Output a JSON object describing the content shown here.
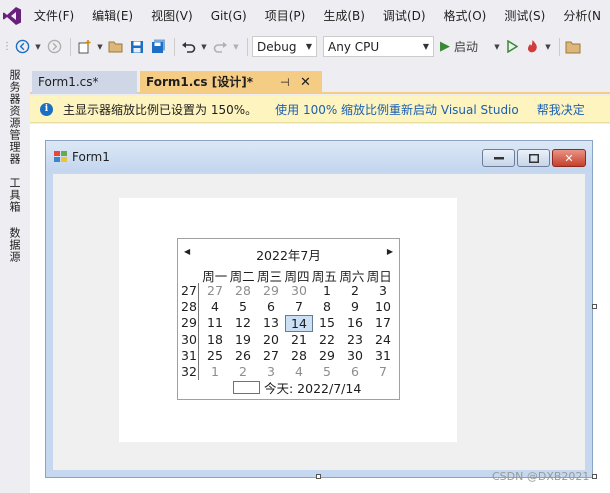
{
  "menu": [
    "文件(F)",
    "编辑(E)",
    "视图(V)",
    "Git(G)",
    "项目(P)",
    "生成(B)",
    "调试(D)",
    "格式(O)",
    "测试(S)",
    "分析(N"
  ],
  "toolbar": {
    "config": "Debug",
    "platform": "Any CPU",
    "start_label": "启动"
  },
  "left_tabs": [
    "服务器资源管理器",
    "工具箱",
    "数据源"
  ],
  "tabs": {
    "inactive": "Form1.cs*",
    "active": "Form1.cs [设计]*"
  },
  "infobar": {
    "message": "主显示器缩放比例已设置为 150%。",
    "link1": "使用 100% 缩放比例重新启动 Visual Studio",
    "link2": "帮我决定"
  },
  "form": {
    "title": "Form1"
  },
  "calendar": {
    "month_title": "2022年7月",
    "weekdays": [
      "周一",
      "周二",
      "周三",
      "周四",
      "周五",
      "周六",
      "周日"
    ],
    "week_numbers": [
      "27",
      "28",
      "29",
      "30",
      "31",
      "32"
    ],
    "rows": [
      [
        {
          "d": "27",
          "dim": true
        },
        {
          "d": "28",
          "dim": true
        },
        {
          "d": "29",
          "dim": true
        },
        {
          "d": "30",
          "dim": true
        },
        {
          "d": "1"
        },
        {
          "d": "2"
        },
        {
          "d": "3"
        }
      ],
      [
        {
          "d": "4"
        },
        {
          "d": "5"
        },
        {
          "d": "6"
        },
        {
          "d": "7"
        },
        {
          "d": "8"
        },
        {
          "d": "9"
        },
        {
          "d": "10"
        }
      ],
      [
        {
          "d": "11"
        },
        {
          "d": "12"
        },
        {
          "d": "13"
        },
        {
          "d": "14",
          "today": true
        },
        {
          "d": "15"
        },
        {
          "d": "16"
        },
        {
          "d": "17"
        }
      ],
      [
        {
          "d": "18"
        },
        {
          "d": "19"
        },
        {
          "d": "20"
        },
        {
          "d": "21"
        },
        {
          "d": "22"
        },
        {
          "d": "23"
        },
        {
          "d": "24"
        }
      ],
      [
        {
          "d": "25"
        },
        {
          "d": "26"
        },
        {
          "d": "27"
        },
        {
          "d": "28"
        },
        {
          "d": "29"
        },
        {
          "d": "30"
        },
        {
          "d": "31"
        }
      ],
      [
        {
          "d": "1",
          "dim": true
        },
        {
          "d": "2",
          "dim": true
        },
        {
          "d": "3",
          "dim": true
        },
        {
          "d": "4",
          "dim": true
        },
        {
          "d": "5",
          "dim": true
        },
        {
          "d": "6",
          "dim": true
        },
        {
          "d": "7",
          "dim": true
        }
      ]
    ],
    "today_label": "今天: 2022/7/14"
  },
  "watermark": "CSDN @DXB2021",
  "colors": {
    "accent": "#f5cc84",
    "link": "#1a5fb4",
    "vs_purple": "#68217a"
  }
}
